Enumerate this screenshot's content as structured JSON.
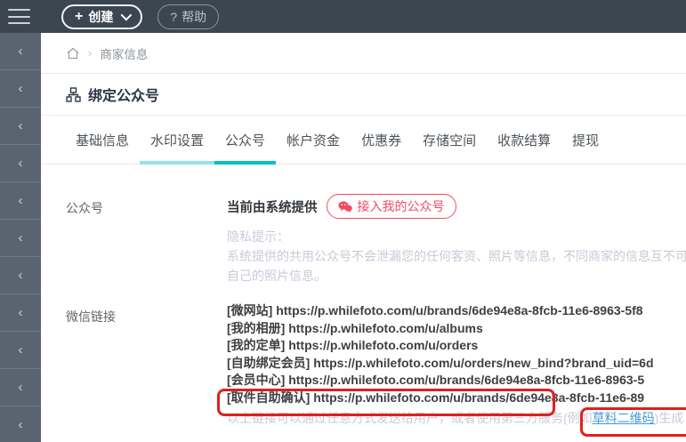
{
  "topbar": {
    "create_label": "创建",
    "create_plus": "+",
    "help_prefix": "?",
    "help_label": "帮助"
  },
  "sidebar": {
    "chevron": "‹"
  },
  "breadcrumb": {
    "separator": "›",
    "item": "商家信息"
  },
  "page": {
    "title": "绑定公众号"
  },
  "tabs": [
    {
      "label": "基础信息"
    },
    {
      "label": "水印设置"
    },
    {
      "label": "公众号"
    },
    {
      "label": "帐户资金"
    },
    {
      "label": "优惠券"
    },
    {
      "label": "存储空间"
    },
    {
      "label": "收款结算"
    },
    {
      "label": "提现"
    }
  ],
  "sections": {
    "mp": {
      "label": "公众号",
      "current_text": "当前由系统提供",
      "connect_button": "接入我的公众号",
      "privacy_line1": "隐私提示：",
      "privacy_line2": "系统提供的共用公众号不会泄漏您的任何客资、照片等信息，不同商家的信息互不可",
      "privacy_line3": "自己的照片信息。"
    },
    "links": {
      "label": "微信链接",
      "items": [
        "[微网站] https://p.whilefoto.com/u/brands/6de94e8a-8fcb-11e6-8963-5f8",
        "[我的相册] https://p.whilefoto.com/u/albums",
        "[我的定单] https://p.whilefoto.com/u/orders",
        "[自助绑定会员] https://p.whilefoto.com/u/orders/new_bind?brand_uid=6d",
        "[会员中心] https://p.whilefoto.com/u/brands/6de94e8a-8fcb-11e6-8963-5",
        "[取件自助确认] https://p.whilefoto.com/u/brands/6de94e8a-8fcb-11e6-89"
      ],
      "hint_before": "以上链接可以通过任意方式发送给用户，或者使用第三方服务(例如",
      "hint_link": "草料二维码",
      "hint_after": ")生成"
    }
  },
  "colors": {
    "topbar_bg": "#3b4651",
    "sidebar_bg": "#5a6470",
    "tab_underline_light": "#97e2ea",
    "tab_underline_dark": "#00c0ce",
    "accent_pink": "#f14b66",
    "annotation_red": "#e01f1f",
    "link_blue": "#4798d9",
    "hint_gray": "#c6cbd6"
  }
}
